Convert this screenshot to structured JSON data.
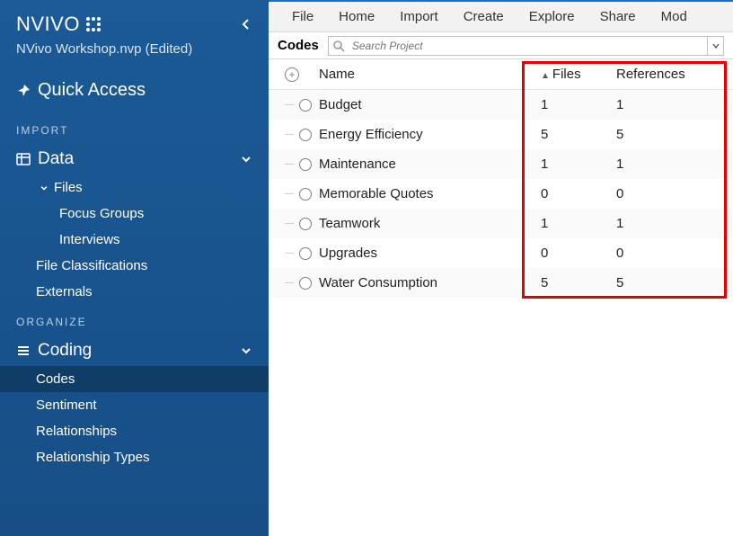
{
  "brand": "NVIVO",
  "project_name": "NVivo Workshop.nvp (Edited)",
  "quick_access": "Quick Access",
  "sections": {
    "import_label": "IMPORT",
    "organize_label": "ORGANIZE"
  },
  "nav": {
    "data": {
      "label": "Data",
      "files": "Files",
      "focus_groups": "Focus Groups",
      "interviews": "Interviews",
      "file_classifications": "File Classifications",
      "externals": "Externals"
    },
    "coding": {
      "label": "Coding",
      "codes": "Codes",
      "sentiment": "Sentiment",
      "relationships": "Relationships",
      "relationship_types": "Relationship Types"
    }
  },
  "top_tabs": [
    "File",
    "Home",
    "Import",
    "Create",
    "Explore",
    "Share",
    "Mod"
  ],
  "panel_title": "Codes",
  "search_placeholder": "Search Project",
  "columns": {
    "name": "Name",
    "files": "Files",
    "refs": "References"
  },
  "rows": [
    {
      "name": "Budget",
      "files": "1",
      "refs": "1"
    },
    {
      "name": "Energy Efficiency",
      "files": "5",
      "refs": "5"
    },
    {
      "name": "Maintenance",
      "files": "1",
      "refs": "1"
    },
    {
      "name": "Memorable Quotes",
      "files": "0",
      "refs": "0"
    },
    {
      "name": "Teamwork",
      "files": "1",
      "refs": "1"
    },
    {
      "name": "Upgrades",
      "files": "0",
      "refs": "0"
    },
    {
      "name": "Water Consumption",
      "files": "5",
      "refs": "5"
    }
  ]
}
